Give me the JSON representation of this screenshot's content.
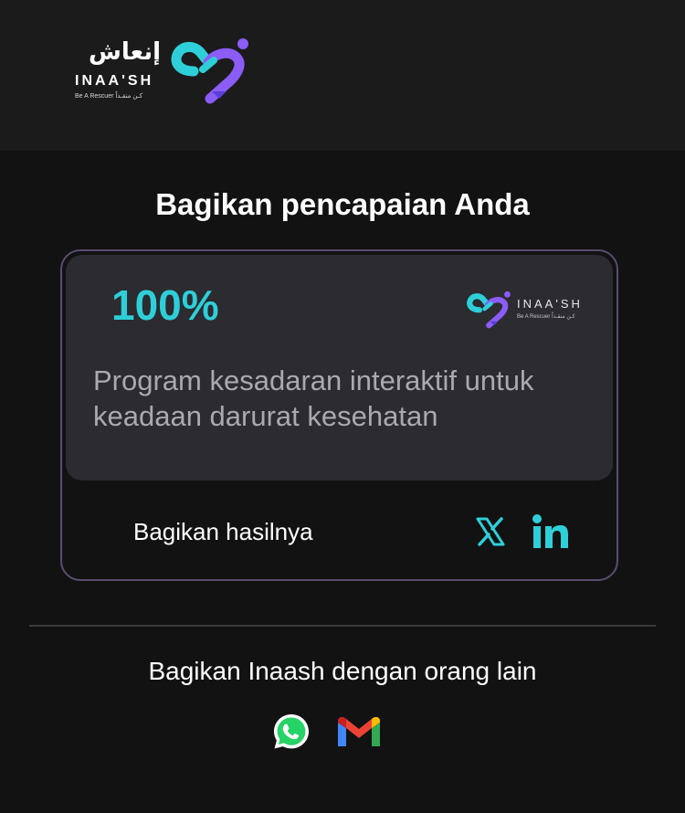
{
  "header": {
    "logo_arabic": "إنعاش",
    "logo_latin": "INAA'SH",
    "logo_tagline": "Be A Rescuer  كـن منقـذاً"
  },
  "achievement": {
    "title": "Bagikan pencapaian Anda",
    "percent": "100%",
    "logo_latin": "INAA'SH",
    "logo_tagline": "Be A Rescuer  كـن منقـذاً",
    "description": "Program kesadaran interaktif untuk keadaan darurat kesehatan",
    "share_label": "Bagikan hasilnya",
    "share_icons": [
      "x-icon",
      "linkedin-icon"
    ]
  },
  "share_app": {
    "label": "Bagikan Inaash dengan orang lain",
    "icons": [
      "whatsapp-icon",
      "gmail-icon"
    ]
  },
  "colors": {
    "accent_teal": "#2ecfd8",
    "accent_purple": "#8b5cf6",
    "card_border": "#5a4c6e",
    "background": "#121212"
  }
}
